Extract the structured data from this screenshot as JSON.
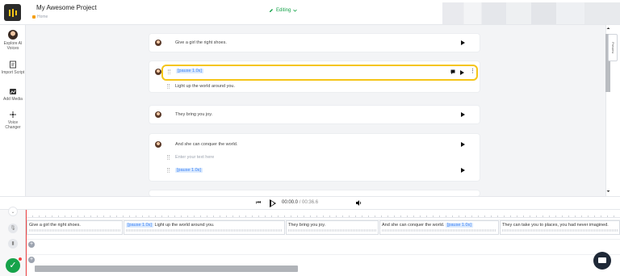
{
  "header": {
    "project_title": "My Awesome Project",
    "breadcrumb": "Home",
    "status_label": "Editing"
  },
  "sidebar": {
    "items": [
      {
        "label": "Explore AI Voices",
        "icon": "avatar-icon"
      },
      {
        "label": "Import Script",
        "icon": "import-icon"
      },
      {
        "label": "Add Media",
        "icon": "media-icon"
      },
      {
        "label": "Voice Changer",
        "icon": "voice-changer-icon"
      }
    ]
  },
  "script": {
    "blocks": [
      {
        "lines": [
          {
            "text": "Give a girl the right shoes."
          }
        ]
      },
      {
        "lines": [
          {
            "pause": "[pause 1.0s]"
          },
          {
            "text": "Light up the world around you."
          }
        ]
      },
      {
        "lines": [
          {
            "text": "They bring you joy."
          }
        ]
      },
      {
        "lines": [
          {
            "text": "And she can conquer the world."
          },
          {
            "placeholder": "Enter your text here"
          },
          {
            "pause": "[pause 1.0s]"
          }
        ]
      }
    ],
    "preview_label": "Preview"
  },
  "player": {
    "current_time": "00:00.0",
    "separator": "/",
    "duration": "00:36.6"
  },
  "timeline": {
    "clips": [
      {
        "text": "Give a girl the right shoes."
      },
      {
        "pause": "[pause 1.0s]",
        "text": "Light up the world around you."
      },
      {
        "text": "They bring you joy."
      },
      {
        "text": "And she can conquer the world.",
        "pause": "[pause 1.0s]"
      },
      {
        "text": "They can take you to places, you had never imagined."
      }
    ]
  },
  "colors": {
    "accent_green": "#16a34a",
    "highlight_yellow": "#f5c518",
    "pause_blue": "#3b82f6"
  }
}
